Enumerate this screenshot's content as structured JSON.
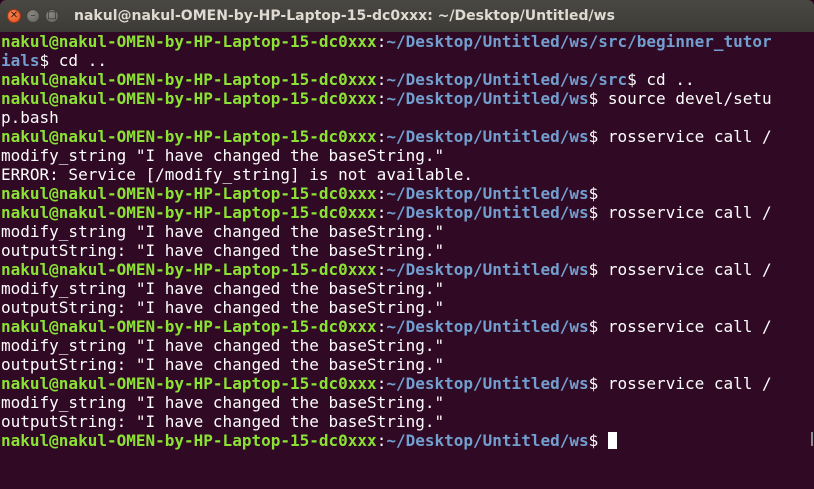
{
  "window": {
    "title": "nakul@nakul-OMEN-by-HP-Laptop-15-dc0xxx: ~/Desktop/Untitled/ws",
    "close_glyph": "✕",
    "minimize_glyph": "–",
    "maximize_glyph": "□"
  },
  "terminal": {
    "lines": [
      {
        "user": "nakul@nakul-OMEN-by-HP-Laptop-15-dc0xxx",
        "sep": ":",
        "path": "~/Desktop/Untitled/ws/src/beginner_tutor",
        "rest": ""
      },
      {
        "user": "",
        "sep": "",
        "path": "ials",
        "rest": "$ cd .."
      },
      {
        "user": "nakul@nakul-OMEN-by-HP-Laptop-15-dc0xxx",
        "sep": ":",
        "path": "~/Desktop/Untitled/ws/src",
        "rest": "$ cd .."
      },
      {
        "user": "nakul@nakul-OMEN-by-HP-Laptop-15-dc0xxx",
        "sep": ":",
        "path": "~/Desktop/Untitled/ws",
        "rest": "$ source devel/setu"
      },
      {
        "user": "",
        "sep": "",
        "path": "",
        "rest": "p.bash"
      },
      {
        "user": "nakul@nakul-OMEN-by-HP-Laptop-15-dc0xxx",
        "sep": ":",
        "path": "~/Desktop/Untitled/ws",
        "rest": "$ rosservice call /"
      },
      {
        "user": "",
        "sep": "",
        "path": "",
        "rest": "modify_string \"I have changed the baseString.\""
      },
      {
        "user": "",
        "sep": "",
        "path": "",
        "rest": "ERROR: Service [/modify_string] is not available."
      },
      {
        "user": "nakul@nakul-OMEN-by-HP-Laptop-15-dc0xxx",
        "sep": ":",
        "path": "~/Desktop/Untitled/ws",
        "rest": "$"
      },
      {
        "user": "nakul@nakul-OMEN-by-HP-Laptop-15-dc0xxx",
        "sep": ":",
        "path": "~/Desktop/Untitled/ws",
        "rest": "$ rosservice call /"
      },
      {
        "user": "",
        "sep": "",
        "path": "",
        "rest": "modify_string \"I have changed the baseString.\""
      },
      {
        "user": "",
        "sep": "",
        "path": "",
        "rest": "outputString: \"I have changed the baseString.\""
      },
      {
        "user": "nakul@nakul-OMEN-by-HP-Laptop-15-dc0xxx",
        "sep": ":",
        "path": "~/Desktop/Untitled/ws",
        "rest": "$ rosservice call /"
      },
      {
        "user": "",
        "sep": "",
        "path": "",
        "rest": "modify_string \"I have changed the baseString.\""
      },
      {
        "user": "",
        "sep": "",
        "path": "",
        "rest": "outputString: \"I have changed the baseString.\""
      },
      {
        "user": "nakul@nakul-OMEN-by-HP-Laptop-15-dc0xxx",
        "sep": ":",
        "path": "~/Desktop/Untitled/ws",
        "rest": "$ rosservice call /"
      },
      {
        "user": "",
        "sep": "",
        "path": "",
        "rest": "modify_string \"I have changed the baseString.\""
      },
      {
        "user": "",
        "sep": "",
        "path": "",
        "rest": "outputString: \"I have changed the baseString.\""
      },
      {
        "user": "nakul@nakul-OMEN-by-HP-Laptop-15-dc0xxx",
        "sep": ":",
        "path": "~/Desktop/Untitled/ws",
        "rest": "$ rosservice call /"
      },
      {
        "user": "",
        "sep": "",
        "path": "",
        "rest": "modify_string \"I have changed the baseString.\""
      },
      {
        "user": "",
        "sep": "",
        "path": "",
        "rest": "outputString: \"I have changed the baseString.\""
      },
      {
        "user": "nakul@nakul-OMEN-by-HP-Laptop-15-dc0xxx",
        "sep": ":",
        "path": "~/Desktop/Untitled/ws",
        "rest": "$ ",
        "cursor": true
      }
    ]
  },
  "colors": {
    "background": "#300a24",
    "prompt_user": "#8ae234",
    "prompt_path": "#729fcf",
    "text": "#ffffff"
  }
}
